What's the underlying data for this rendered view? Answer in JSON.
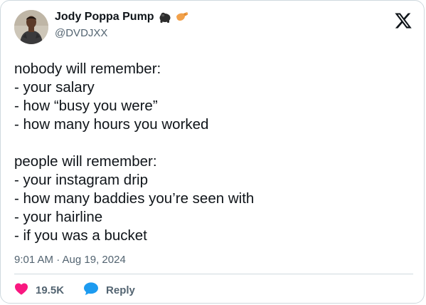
{
  "author": {
    "display_name": "Jody Poppa Pump",
    "handle": "@DVDJXX",
    "name_emojis": [
      "gorilla-emoji",
      "flexed-biceps-emoji"
    ]
  },
  "platform": {
    "logo": "x-logo-icon"
  },
  "tweet": {
    "lines": [
      "nobody will remember:",
      "- your salary",
      "- how “busy you were”",
      "- how many hours you worked",
      "",
      "people will remember:",
      "- your instagram drip",
      "- how many baddies you’re seen with",
      "- your hairline",
      "- if you was a bucket"
    ],
    "timestamp": "9:01 AM · Aug 19, 2024"
  },
  "actions": {
    "like": {
      "icon": "heart-icon",
      "count": "19.5K",
      "color": "#f91880"
    },
    "reply": {
      "icon": "speech-bubble-icon",
      "label": "Reply",
      "color": "#1d9bf0"
    }
  },
  "colors": {
    "text_primary": "#0f1419",
    "text_secondary": "#536471",
    "border": "#cfd9de"
  }
}
